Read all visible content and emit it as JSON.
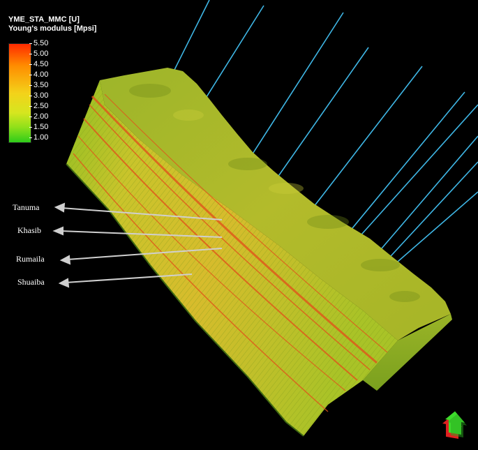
{
  "legend": {
    "title": "YME_STA_MMC [U]",
    "subtitle": "Young's modulus [Mpsi]",
    "ticks": [
      "5.50",
      "5.00",
      "4.50",
      "4.00",
      "3.50",
      "3.00",
      "2.50",
      "2.00",
      "1.50",
      "1.00"
    ],
    "gradient_colors": [
      "#ff2a00",
      "#ff8c00",
      "#f3d21a",
      "#d6e61f",
      "#8ee01a",
      "#2ecc1a"
    ]
  },
  "layers": [
    {
      "label": "Tanuma"
    },
    {
      "label": "Khasib"
    },
    {
      "label": "Rumaila"
    },
    {
      "label": "Shuaiba"
    }
  ],
  "colors": {
    "background": "#000000",
    "model_top": "#a6b22a",
    "model_front": "#c3c42a",
    "model_side": "#8ea823",
    "stripe_red": "#e0551a",
    "well": "#3fb7e6",
    "arrow": "#cfcfcf"
  },
  "orientation_indicator": {
    "icon": "north-arrow-icon"
  }
}
